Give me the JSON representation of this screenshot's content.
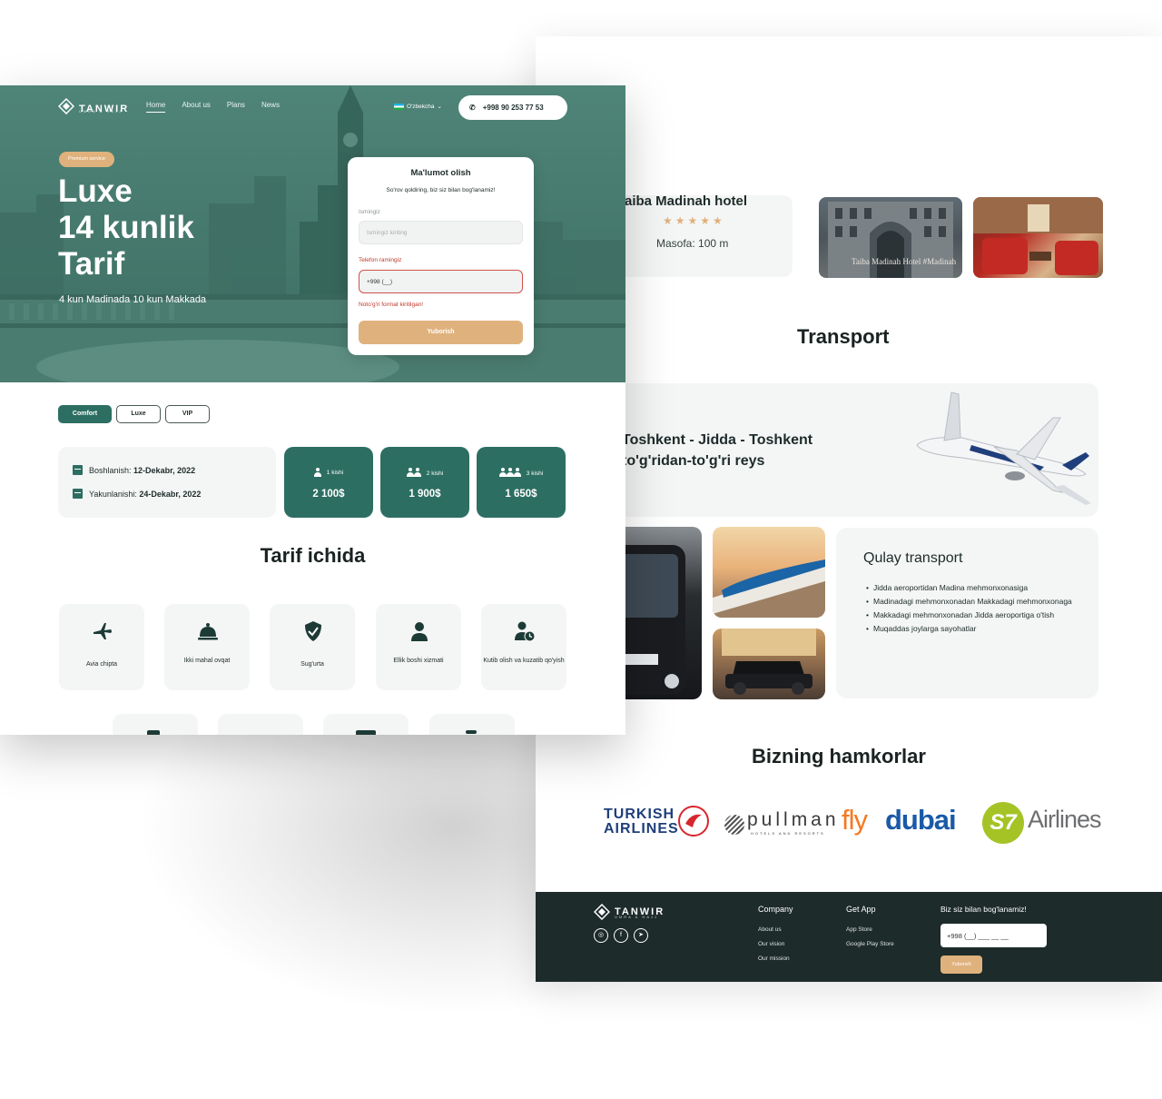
{
  "brand": {
    "name": "TANWIR",
    "tagline": "UMRA & HAJJ"
  },
  "nav": {
    "links": [
      "Home",
      "About us",
      "Plans",
      "News"
    ],
    "language": "O'zbekcha",
    "phone": "+998 90 253 77 53"
  },
  "hero": {
    "badge": "Premium service",
    "title_line1": "Luxe",
    "title_line2": "14 kunlik",
    "title_line3": "Tarif",
    "subtitle": "4 kun Madinada 10 kun Makkada"
  },
  "form": {
    "title": "Ma'lumot olish",
    "subtitle": "So'rov qoldiring, biz siz bilan bog'lanamiz!",
    "name_label": "Ismingiz",
    "name_placeholder": "Ismingiz kiriting",
    "phone_label": "Telefon ramingiz",
    "phone_value": "+998 (__)",
    "error": "Noto'g'ri format kiritilgan!",
    "submit": "Yuborish"
  },
  "tabs": [
    "Comfort",
    "Luxe",
    "VIP"
  ],
  "dates": {
    "start_label": "Boshlanish:",
    "start_value": "12-Dekabr, 2022",
    "end_label": "Yakunlanishi:",
    "end_value": "24-Dekabr, 2022"
  },
  "prices": [
    {
      "who": "1 kishi",
      "value": "2 100$"
    },
    {
      "who": "2 kishi",
      "value": "1 900$"
    },
    {
      "who": "3 kishi",
      "value": "1 650$"
    }
  ],
  "tarif": {
    "title": "Tarif ichida",
    "features": [
      "Avia chipta",
      "Ikki mahal ovqat",
      "Sug'urta",
      "Ellik boshi xizmati",
      "Kutib olish va kuzatib qo'yish"
    ]
  },
  "hotel": {
    "name": "aiba Madinah hotel",
    "rating": 5,
    "stars": "★★★★★",
    "distance": "Masofa: 100 m",
    "photo_caption": "Taiba Madinah Hotel #Madinah"
  },
  "transport": {
    "title": "Transport",
    "flight_line1": "Toshkent - Jidda - Toshkent",
    "flight_line2": "to'g'ridan-to'g'ri reys",
    "quick_title": "Qulay transport",
    "quick_items": [
      "Jidda aeroportidan Madina mehmonxonasiga",
      "Madinadagi mehmonxonadan Makkadagi mehmonxonaga",
      "Makkadagi mehmonxonadan Jidda aeroportiga o'tish",
      "Muqaddas joylarga sayohatlar"
    ]
  },
  "partners": {
    "title": "Bizning hamkorlar",
    "turkish_1": "TURKISH",
    "turkish_2": "AIRLINES",
    "pullman": "pullman",
    "pullman_sub": "HOTELS AND RESORTS",
    "fly": "fly",
    "dubai": "dubai",
    "s7": "S7",
    "airlines": "Airlines"
  },
  "footer": {
    "company_title": "Company",
    "company_links": [
      "About us",
      "Our vision",
      "Our mission"
    ],
    "app_title": "Get App",
    "app_links": [
      "App Store",
      "Google Play Store"
    ],
    "contact_title": "Biz siz bilan bog'lanamiz!",
    "phone_placeholder": "+998 (__) ___ __ __",
    "submit": "Yuborish"
  },
  "colors": {
    "primary": "#2d6e62",
    "accent": "#dfb27d",
    "dark": "#1d2b2a",
    "card": "#f4f6f5"
  }
}
